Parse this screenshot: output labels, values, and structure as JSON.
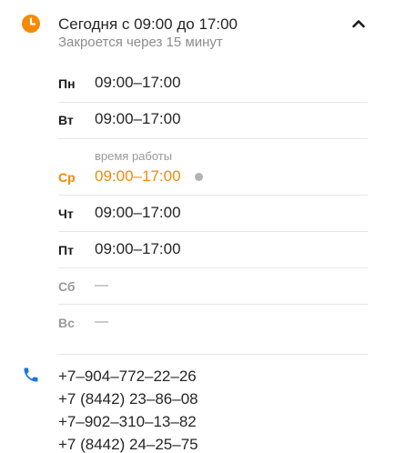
{
  "header": {
    "title": "Сегодня с 09:00 до 17:00",
    "subtitle": "Закроется через 15 минут"
  },
  "schedule": [
    {
      "day": "Пн",
      "hours": "09:00–17:00"
    },
    {
      "day": "Вт",
      "hours": "09:00–17:00"
    },
    {
      "day": "Ср",
      "hours": "09:00–17:00",
      "caption": "время работы",
      "today": true
    },
    {
      "day": "Чт",
      "hours": "09:00–17:00"
    },
    {
      "day": "Пт",
      "hours": "09:00–17:00"
    },
    {
      "day": "Сб",
      "hours": "—"
    },
    {
      "day": "Вс",
      "hours": "—"
    }
  ],
  "phones": [
    "+7‒904‒772‒22‒26",
    "+7 (8442) 23‒86‒08",
    "+7‒902‒310‒13‒82",
    "+7 (8442) 24‒25‒75"
  ],
  "colors": {
    "accent_orange": "#f58a00",
    "phone_icon_blue": "#1a73e8",
    "muted_text": "#8c8c8c",
    "separator": "#e6e6e6"
  },
  "icons": {
    "hours": "clock-icon",
    "collapse": "chevron-up-icon",
    "phone": "phone-icon"
  }
}
